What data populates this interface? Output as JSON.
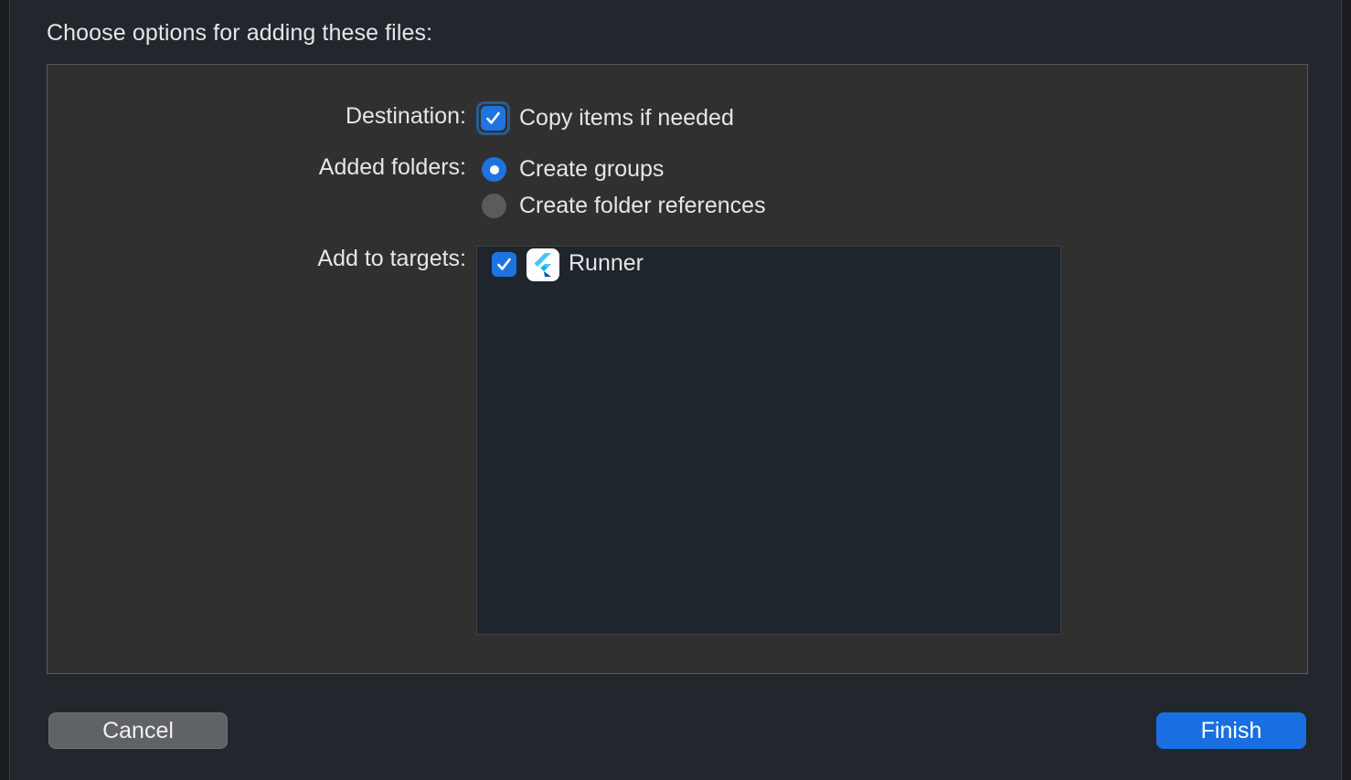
{
  "dialog": {
    "prompt": "Choose options for adding these files:",
    "destination": {
      "label": "Destination:",
      "option_label": "Copy items if needed",
      "checked": true
    },
    "added_folders": {
      "label": "Added folders:",
      "options": [
        {
          "label": "Create groups",
          "selected": true
        },
        {
          "label": "Create folder references",
          "selected": false
        }
      ]
    },
    "targets": {
      "label": "Add to targets:",
      "items": [
        {
          "name": "Runner",
          "checked": true,
          "icon": "flutter-icon"
        }
      ]
    },
    "buttons": {
      "cancel": "Cancel",
      "finish": "Finish"
    }
  },
  "colors": {
    "accent": "#1f73e0",
    "panel": "#303030",
    "sheet": "#21272d"
  }
}
